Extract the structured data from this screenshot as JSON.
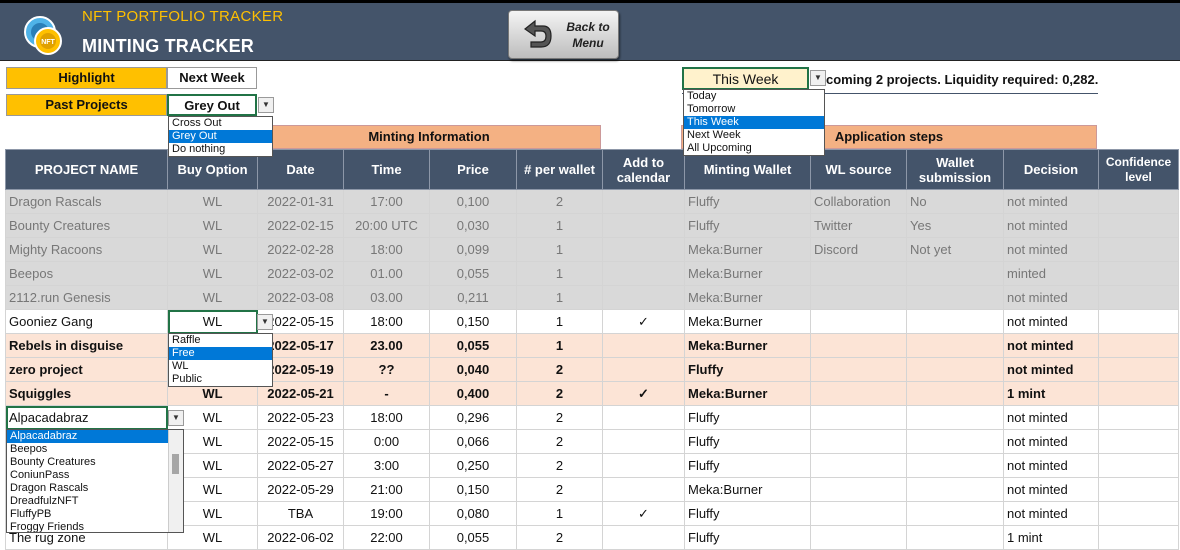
{
  "header": {
    "app_title": "NFT PORTFOLIO TRACKER",
    "page_title": "MINTING TRACKER",
    "back_button": "Back to Menu"
  },
  "controls": {
    "highlight_label": "Highlight",
    "highlight_value": "Next Week",
    "past_label": "Past Projects",
    "past_value": "Grey Out",
    "past_options": [
      {
        "label": "Cross Out",
        "selected": false
      },
      {
        "label": "Grey Out",
        "selected": true
      },
      {
        "label": "Do nothing",
        "selected": false
      }
    ],
    "week_value": "This Week",
    "week_options": [
      {
        "label": "Today",
        "selected": false
      },
      {
        "label": "Tomorrow",
        "selected": false
      },
      {
        "label": "This Week",
        "selected": true
      },
      {
        "label": "Next Week",
        "selected": false
      },
      {
        "label": "All Upcoming",
        "selected": false
      }
    ],
    "upcoming_text": "coming 2 projects. Liquidity required: 0,282."
  },
  "sections": {
    "minting_info": "Minting Information",
    "application_steps": "Application steps"
  },
  "table": {
    "columns": [
      "PROJECT NAME",
      "Buy Option",
      "Date",
      "Time",
      "Price",
      "# per wallet",
      "Add to calendar",
      "Minting Wallet",
      "WL source",
      "Wallet submission",
      "Decision",
      "Confidence level"
    ],
    "rows": [
      {
        "style": "past",
        "name": "Dragon Rascals",
        "buy": "WL",
        "date": "2022-01-31",
        "time": "17:00",
        "price": "0,100",
        "per_wallet": "2",
        "calendar": "",
        "wallet": "Fluffy",
        "wl_source": "Collaboration",
        "submission": "No",
        "decision": "not minted",
        "confidence": ""
      },
      {
        "style": "past",
        "name": "Bounty Creatures",
        "buy": "WL",
        "date": "2022-02-15",
        "time": "20:00 UTC",
        "price": "0,030",
        "per_wallet": "1",
        "calendar": "",
        "wallet": "Fluffy",
        "wl_source": "Twitter",
        "submission": "Yes",
        "decision": "not minted",
        "confidence": ""
      },
      {
        "style": "past",
        "name": "Mighty Racoons",
        "buy": "WL",
        "date": "2022-02-28",
        "time": "18:00",
        "price": "0,099",
        "per_wallet": "1",
        "calendar": "",
        "wallet": "Meka:Burner",
        "wl_source": "Discord",
        "submission": "Not yet",
        "decision": "not minted",
        "confidence": ""
      },
      {
        "style": "past",
        "name": "Beepos",
        "buy": "WL",
        "date": "2022-03-02",
        "time": "01.00",
        "price": "0,055",
        "per_wallet": "1",
        "calendar": "",
        "wallet": "Meka:Burner",
        "wl_source": "",
        "submission": "",
        "decision": "minted",
        "confidence": ""
      },
      {
        "style": "past",
        "name": "2112.run Genesis",
        "buy": "WL",
        "date": "2022-03-08",
        "time": "03.00",
        "price": "0,211",
        "per_wallet": "1",
        "calendar": "",
        "wallet": "Meka:Burner",
        "wl_source": "",
        "submission": "",
        "decision": "not minted",
        "confidence": ""
      },
      {
        "style": "norm",
        "name": "Gooniez Gang",
        "buy": "WL",
        "date": "2022-05-15",
        "time": "18:00",
        "price": "0,150",
        "per_wallet": "1",
        "calendar": "✓",
        "wallet": "Meka:Burner",
        "wl_source": "",
        "submission": "",
        "decision": "not minted",
        "confidence": ""
      },
      {
        "style": "hl",
        "name": "Rebels in disguise",
        "buy": "",
        "date": "2022-05-17",
        "time": "23.00",
        "price": "0,055",
        "per_wallet": "1",
        "calendar": "",
        "wallet": "Meka:Burner",
        "wl_source": "",
        "submission": "",
        "decision": "not minted",
        "confidence": ""
      },
      {
        "style": "hl",
        "name": "zero project",
        "buy": "",
        "date": "2022-05-19",
        "time": "??",
        "price": "0,040",
        "per_wallet": "2",
        "calendar": "",
        "wallet": "Fluffy",
        "wl_source": "",
        "submission": "",
        "decision": "not minted",
        "confidence": ""
      },
      {
        "style": "hl",
        "name": "Squiggles",
        "buy": "WL",
        "date": "2022-05-21",
        "time": "-",
        "price": "0,400",
        "per_wallet": "2",
        "calendar": "✓",
        "wallet": "Meka:Burner",
        "wl_source": "",
        "submission": "",
        "decision": "1 mint",
        "confidence": ""
      },
      {
        "style": "norm",
        "name": "Alpacadabraz",
        "buy": "WL",
        "date": "2022-05-23",
        "time": "18:00",
        "price": "0,296",
        "per_wallet": "2",
        "calendar": "",
        "wallet": "Fluffy",
        "wl_source": "",
        "submission": "",
        "decision": "not minted",
        "confidence": ""
      },
      {
        "style": "norm",
        "name": "",
        "buy": "WL",
        "date": "2022-05-15",
        "time": "0:00",
        "price": "0,066",
        "per_wallet": "2",
        "calendar": "",
        "wallet": "Fluffy",
        "wl_source": "",
        "submission": "",
        "decision": "not minted",
        "confidence": ""
      },
      {
        "style": "norm",
        "name": "",
        "buy": "WL",
        "date": "2022-05-27",
        "time": "3:00",
        "price": "0,250",
        "per_wallet": "2",
        "calendar": "",
        "wallet": "Fluffy",
        "wl_source": "",
        "submission": "",
        "decision": "not minted",
        "confidence": ""
      },
      {
        "style": "norm",
        "name": "",
        "buy": "WL",
        "date": "2022-05-29",
        "time": "21:00",
        "price": "0,150",
        "per_wallet": "2",
        "calendar": "",
        "wallet": "Meka:Burner",
        "wl_source": "",
        "submission": "",
        "decision": "not minted",
        "confidence": ""
      },
      {
        "style": "norm",
        "name": "",
        "buy": "WL",
        "date": "TBA",
        "time": "19:00",
        "price": "0,080",
        "per_wallet": "1",
        "calendar": "✓",
        "wallet": "Fluffy",
        "wl_source": "",
        "submission": "",
        "decision": "not minted",
        "confidence": ""
      },
      {
        "style": "norm",
        "name": "The rug zone",
        "buy": "WL",
        "date": "2022-06-02",
        "time": "22:00",
        "price": "0,055",
        "per_wallet": "2",
        "calendar": "",
        "wallet": "Fluffy",
        "wl_source": "",
        "submission": "",
        "decision": "1 mint",
        "confidence": ""
      }
    ]
  },
  "buy_option_dropdown": {
    "value": "WL",
    "options": [
      {
        "label": "Raffle",
        "selected": false
      },
      {
        "label": "Free",
        "selected": true
      },
      {
        "label": "WL",
        "selected": false
      },
      {
        "label": "Public",
        "selected": false
      }
    ]
  },
  "project_dropdown": {
    "value": "Alpacadabraz",
    "options": [
      {
        "label": "Alpacadabraz",
        "selected": true
      },
      {
        "label": "Beepos",
        "selected": false
      },
      {
        "label": "Bounty Creatures",
        "selected": false
      },
      {
        "label": "ConiunPass",
        "selected": false
      },
      {
        "label": "Dragon Rascals",
        "selected": false
      },
      {
        "label": "DreadfulzNFT",
        "selected": false
      },
      {
        "label": "FluffyPB",
        "selected": false
      },
      {
        "label": "Froggy Friends",
        "selected": false
      }
    ]
  },
  "icons": {
    "logo": "nft-coin-logo-icon",
    "back": "back-arrow-icon",
    "dropdown": "chevron-down-icon",
    "checkmark": "checkmark-icon"
  },
  "colors": {
    "header_bg": "#44546a",
    "accent_gold": "#ffc000",
    "section_bg": "#f4b183",
    "highlight_row": "#fce4d6",
    "past_row": "#d9d9d9",
    "selection_blue": "#0078d7"
  }
}
